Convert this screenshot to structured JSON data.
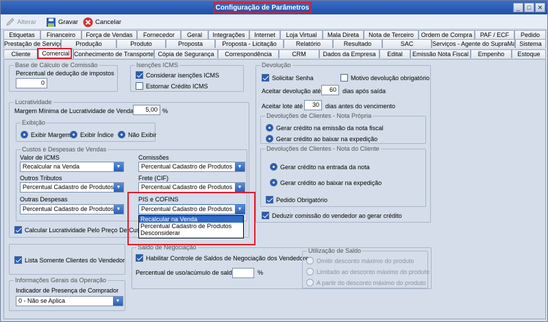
{
  "window": {
    "title": "Configuração de Parâmetros"
  },
  "toolbar": {
    "alterar": "Alterar",
    "gravar": "Gravar",
    "cancelar": "Cancelar"
  },
  "tabs": {
    "row1": [
      "Etiquetas",
      "Financeiro",
      "Força de Vendas",
      "Fornecedor",
      "Geral",
      "Integrações",
      "Internet",
      "Loja Virtual",
      "Mala Direta",
      "Nota de Terceiro",
      "Ordem de Compra",
      "PAF / ECF",
      "Pedido"
    ],
    "row2": [
      "Prestação de Serviços",
      "Produção",
      "Produto",
      "Proposta",
      "Proposta - Licitação",
      "Relatório",
      "Resultado",
      "SAC",
      "Serviços - Agente do SupraMais",
      "Sistema"
    ],
    "row3": [
      "Cliente",
      "Comercial",
      "Conhecimento de Transporte",
      "Cópia de Segurança",
      "Correspondência",
      "CRM",
      "Dados da Empresa",
      "Edital",
      "Emissão Nota Fiscal",
      "Empenho",
      "Estoque"
    ]
  },
  "comissao": {
    "legend": "Base de Cálculo de Comissão",
    "label": "Percentual de dedução de impostos",
    "value": "0"
  },
  "icms": {
    "legend": "Isenções ICMS",
    "considerar": "Considerar isenções ICMS",
    "estornar": "Estornar Crédito ICMS"
  },
  "lucratividade": {
    "legend": "Lucratividade",
    "margem_label": "Margem Mínima de Lucratividade de Vendas",
    "margem_value": "5,00",
    "percent": "%",
    "exibicao": {
      "legend": "Exibição",
      "opt1": "Exibir Margem",
      "opt2": "Exibir Índice",
      "opt3": "Não Exibir"
    },
    "custos": {
      "legend": "Custos e Despesas de Vendas",
      "valor_icms": "Valor de ICMS",
      "valor_icms_val": "Recalcular na Venda",
      "comissoes": "Comissões",
      "comissoes_val": "Percentual Cadastro de Produtos",
      "outros_tributos": "Outros Tributos",
      "outros_tributos_val": "Percentual Cadastro de Produtos",
      "frete": "Frete (CIF)",
      "frete_val": "Percentual Cadastro de Produtos",
      "outras_despesas": "Outras Despesas",
      "outras_despesas_val": "Percentual Cadastro de Produtos",
      "pis": "PIS e COFINS",
      "pis_val": "Percentual Cadastro de Produtos",
      "dropdown": [
        "Recalcular na Venda",
        "Percentual Cadastro de Produtos",
        "Desconsiderar"
      ]
    },
    "calcular": "Calcular Lucratividade Pelo Preço De Custo"
  },
  "lista_clientes": "Lista Somente Clientes do Vendedor",
  "operacao": {
    "legend": "Informações Gerais da Operação",
    "label": "Indicador de Presença de Comprador",
    "value": "0 - Não se Aplica"
  },
  "negociacao": {
    "legend": "Saldo de Negociação",
    "habilitar": "Habilitar Controle de Saldos de Negociação dos Vendedores",
    "percentual": "Percentual de uso/acúmulo de saldo",
    "percent": "%"
  },
  "utilizacao": {
    "legend": "Utilização de Saldo",
    "opt1": "Omitir desconto máximo do produto",
    "opt2": "Limitado ao desconto máximo do produto",
    "opt3": "A partir do desconto máximo do produto"
  },
  "devolucao": {
    "legend": "Devolução",
    "solicitar": "Solicitar Senha",
    "motivo": "Motivo devolução obrigatório",
    "aceitar_dev": "Aceitar devolução até",
    "aceitar_dev_val": "60",
    "aceitar_dev_suf": "dias após saída",
    "aceitar_lote": "Aceitar lote até",
    "aceitar_lote_val": "30",
    "aceitar_lote_suf": "dias antes do vencimento",
    "propria": {
      "legend": "Devoluções de Clientes - Nota Própria",
      "opt1": "Gerar crédito na emissão da nota fiscal",
      "opt2": "Gerar crédito ao baixar na expedição"
    },
    "cliente": {
      "legend": "Devoluções de Clientes - Nota do Cliente",
      "opt1": "Gerar crédito na entrada da nota",
      "opt2": "Gerar crédito ao baixar na expedição",
      "pedido": "Pedido Obrigatório"
    },
    "deduzir": "Deduzir comissão do vendedor ao gerar crédito"
  },
  "colors": {
    "accent": "#2a5db0",
    "highlight": "#e8192c"
  }
}
